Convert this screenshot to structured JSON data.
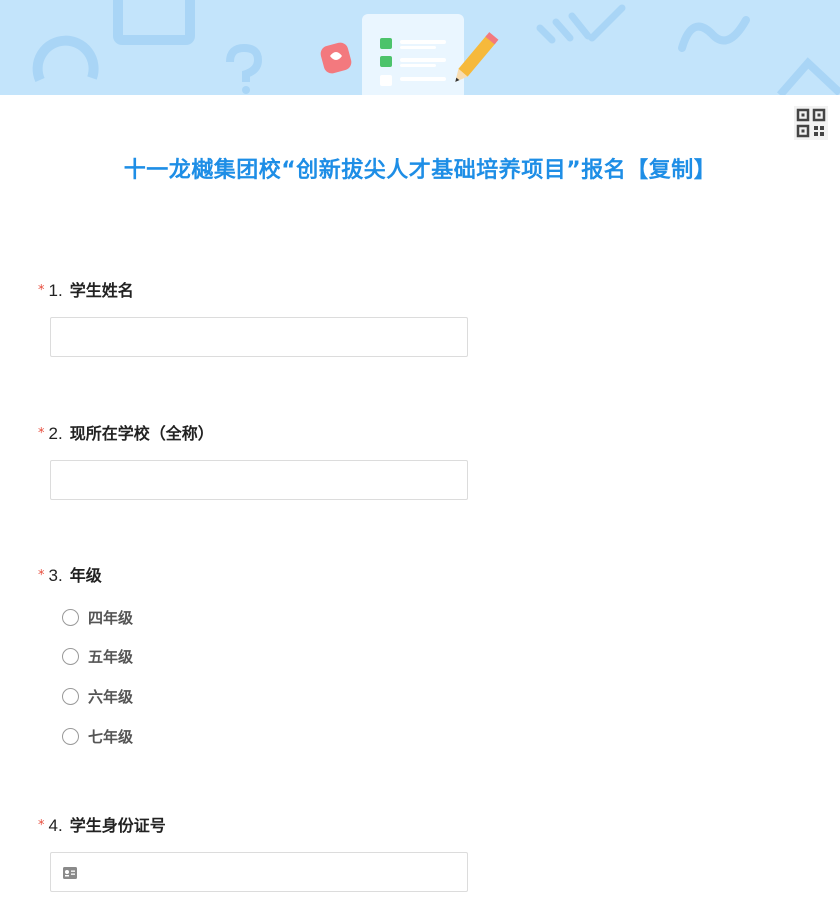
{
  "form": {
    "title": "十一龙樾集团校“创新拔尖人才基础培养项目”报名【复制】"
  },
  "header": {
    "qr_icon": "qr-code-icon"
  },
  "questions": [
    {
      "required_mark": "*",
      "number": "1.",
      "label": "学生姓名",
      "type": "text",
      "value": ""
    },
    {
      "required_mark": "*",
      "number": "2.",
      "label": "现所在学校（全称）",
      "type": "text",
      "value": ""
    },
    {
      "required_mark": "*",
      "number": "3.",
      "label": "年级",
      "type": "radio",
      "options": [
        "四年级",
        "五年级",
        "六年级",
        "七年级"
      ]
    },
    {
      "required_mark": "*",
      "number": "4.",
      "label": "学生身份证号",
      "type": "id-text",
      "value": "",
      "icon": "id-card-icon"
    }
  ],
  "colors": {
    "banner_bg": "#c3e4fb",
    "title": "#1e8ee6",
    "required": "#e74c3c"
  }
}
